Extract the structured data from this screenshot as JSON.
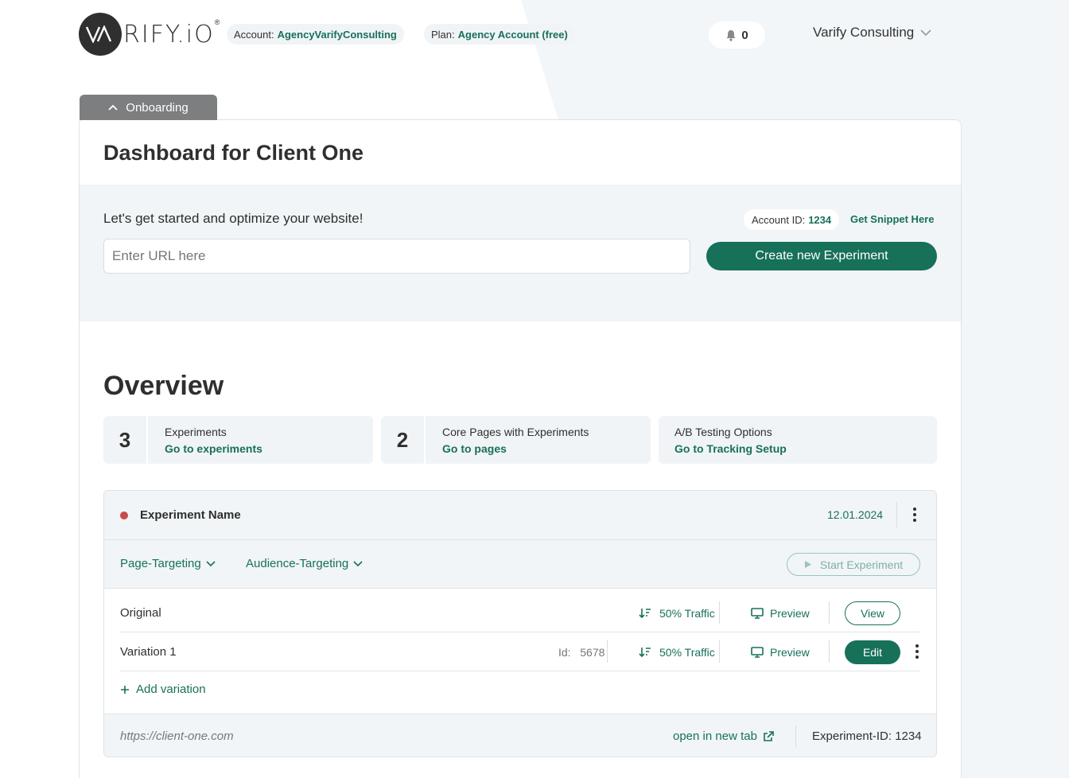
{
  "header": {
    "logo_text": "RIFY.iO",
    "logo_reg": "®",
    "account_label": "Account:",
    "account_value": "AgencyVarifyConsulting",
    "plan_label": "Plan:",
    "plan_value": "Agency Account (free)",
    "notifications_count": "0",
    "user_name": "Varify Consulting"
  },
  "onboarding": {
    "label": "Onboarding"
  },
  "dashboard": {
    "title": "Dashboard for Client One",
    "start_text": "Let's get started and optimize your website!",
    "account_id_label": "Account ID:",
    "account_id_value": "1234",
    "snippet_link": "Get Snippet Here",
    "url_placeholder": "Enter URL here",
    "create_button": "Create new Experiment"
  },
  "overview": {
    "title": "Overview",
    "stats": [
      {
        "number": "3",
        "label": "Experiments",
        "link": "Go to experiments"
      },
      {
        "number": "2",
        "label": "Core Pages with Experiments",
        "link": "Go to pages"
      },
      {
        "number": "",
        "label": "A/B Testing Options",
        "link": "Go to Tracking Setup"
      }
    ]
  },
  "experiment": {
    "name": "Experiment Name",
    "status_color": "#c94b4b",
    "date": "12.01.2024",
    "page_targeting": "Page-Targeting",
    "audience_targeting": "Audience-Targeting",
    "start_button": "Start Experiment",
    "variations": [
      {
        "name": "Original",
        "id_label": "",
        "id_value": "",
        "traffic": "50% Traffic",
        "preview": "Preview",
        "action": "View"
      },
      {
        "name": "Variation 1",
        "id_label": "Id:",
        "id_value": "5678",
        "traffic": "50% Traffic",
        "preview": "Preview",
        "action": "Edit"
      }
    ],
    "add_variation": "Add variation",
    "url": "https://client-one.com",
    "open_new_tab": "open in new tab",
    "experiment_id": "Experiment-ID: 1234"
  },
  "colors": {
    "accent": "#17705a",
    "panel": "#f1f5f7",
    "tab": "#7c7e80"
  }
}
